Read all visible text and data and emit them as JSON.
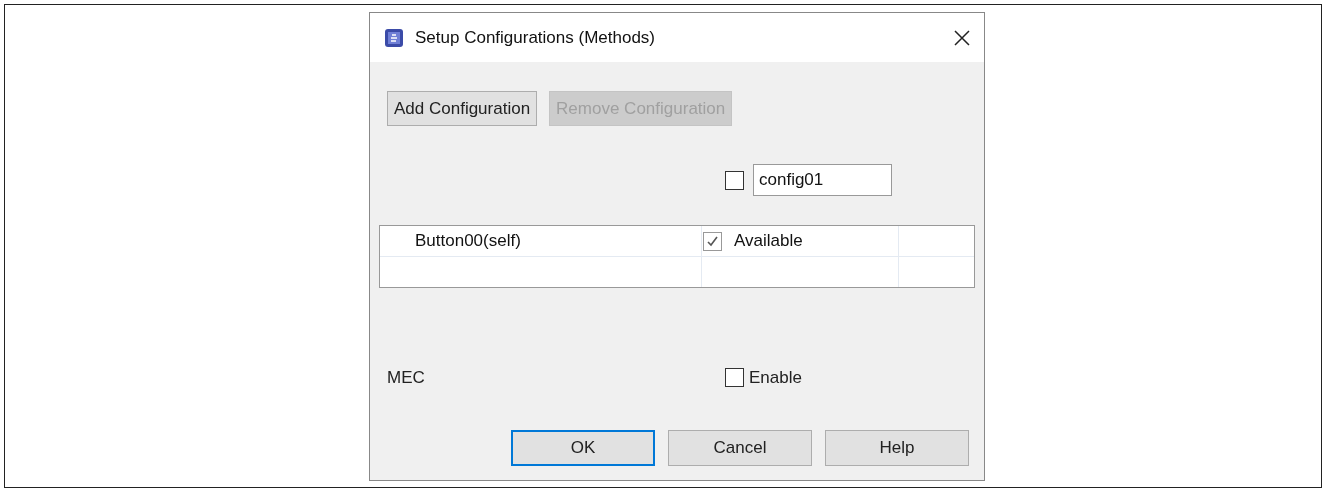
{
  "window": {
    "title": "Setup Configurations (Methods)"
  },
  "toolbar": [
    {
      "label": "Add Configuration",
      "disabled": false
    },
    {
      "label": "Remove Configuration",
      "disabled": true
    }
  ],
  "config": {
    "checked": false,
    "value": "config01"
  },
  "table": {
    "rows": [
      {
        "name": "Button00(self)",
        "checked": true,
        "status": "Available"
      }
    ]
  },
  "mec": {
    "label": "MEC",
    "checked": false,
    "option": "Enable"
  },
  "buttons": [
    {
      "label": "OK",
      "default": true
    },
    {
      "label": "Cancel",
      "default": false
    },
    {
      "label": "Help",
      "default": false
    }
  ]
}
